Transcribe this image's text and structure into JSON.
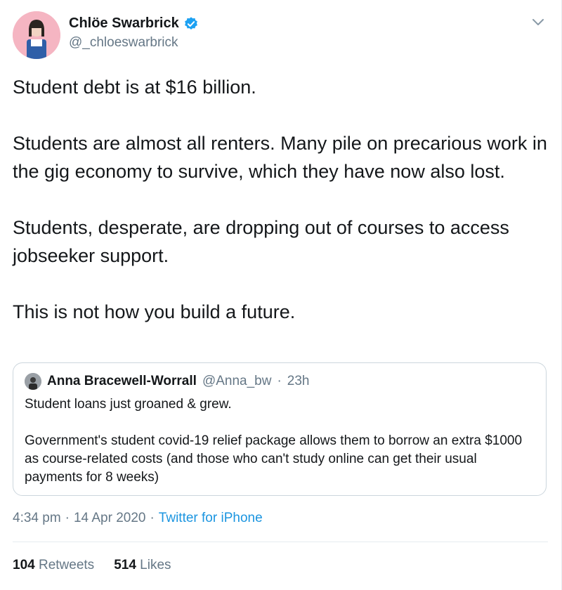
{
  "tweet": {
    "author_name": "Chlöe Swarbrick",
    "author_handle": "@_chloeswarbrick",
    "paragraphs": [
      "Student debt is at $16 billion.",
      "Students are almost all renters. Many pile on precarious work in the gig economy to survive, which they have now also lost.",
      "Students, desperate, are dropping out of courses to access jobseeker support.",
      "This is not how you build a future."
    ],
    "quoted": {
      "author_name": "Anna Bracewell-Worrall",
      "author_handle": "@Anna_bw",
      "dot": "·",
      "time": "23h",
      "paragraphs": [
        "Student loans just groaned & grew.",
        "Government's student covid-19 relief package allows them to borrow an extra $1000 as course-related costs (and those who can't study online can get their usual payments for 8 weeks)"
      ]
    },
    "time": "4:34 pm",
    "date": "14 Apr 2020",
    "sep": "·",
    "source": "Twitter for iPhone",
    "retweets_count": "104",
    "retweets_label": "Retweets",
    "likes_count": "514",
    "likes_label": "Likes"
  },
  "colors": {
    "accent": "#1da1f2",
    "link": "#1b95e0",
    "muted": "#657786",
    "avatar_bg": "#f5b5c2"
  },
  "icons": {
    "verified": "verified-badge-icon",
    "caret": "chevron-down-icon"
  }
}
